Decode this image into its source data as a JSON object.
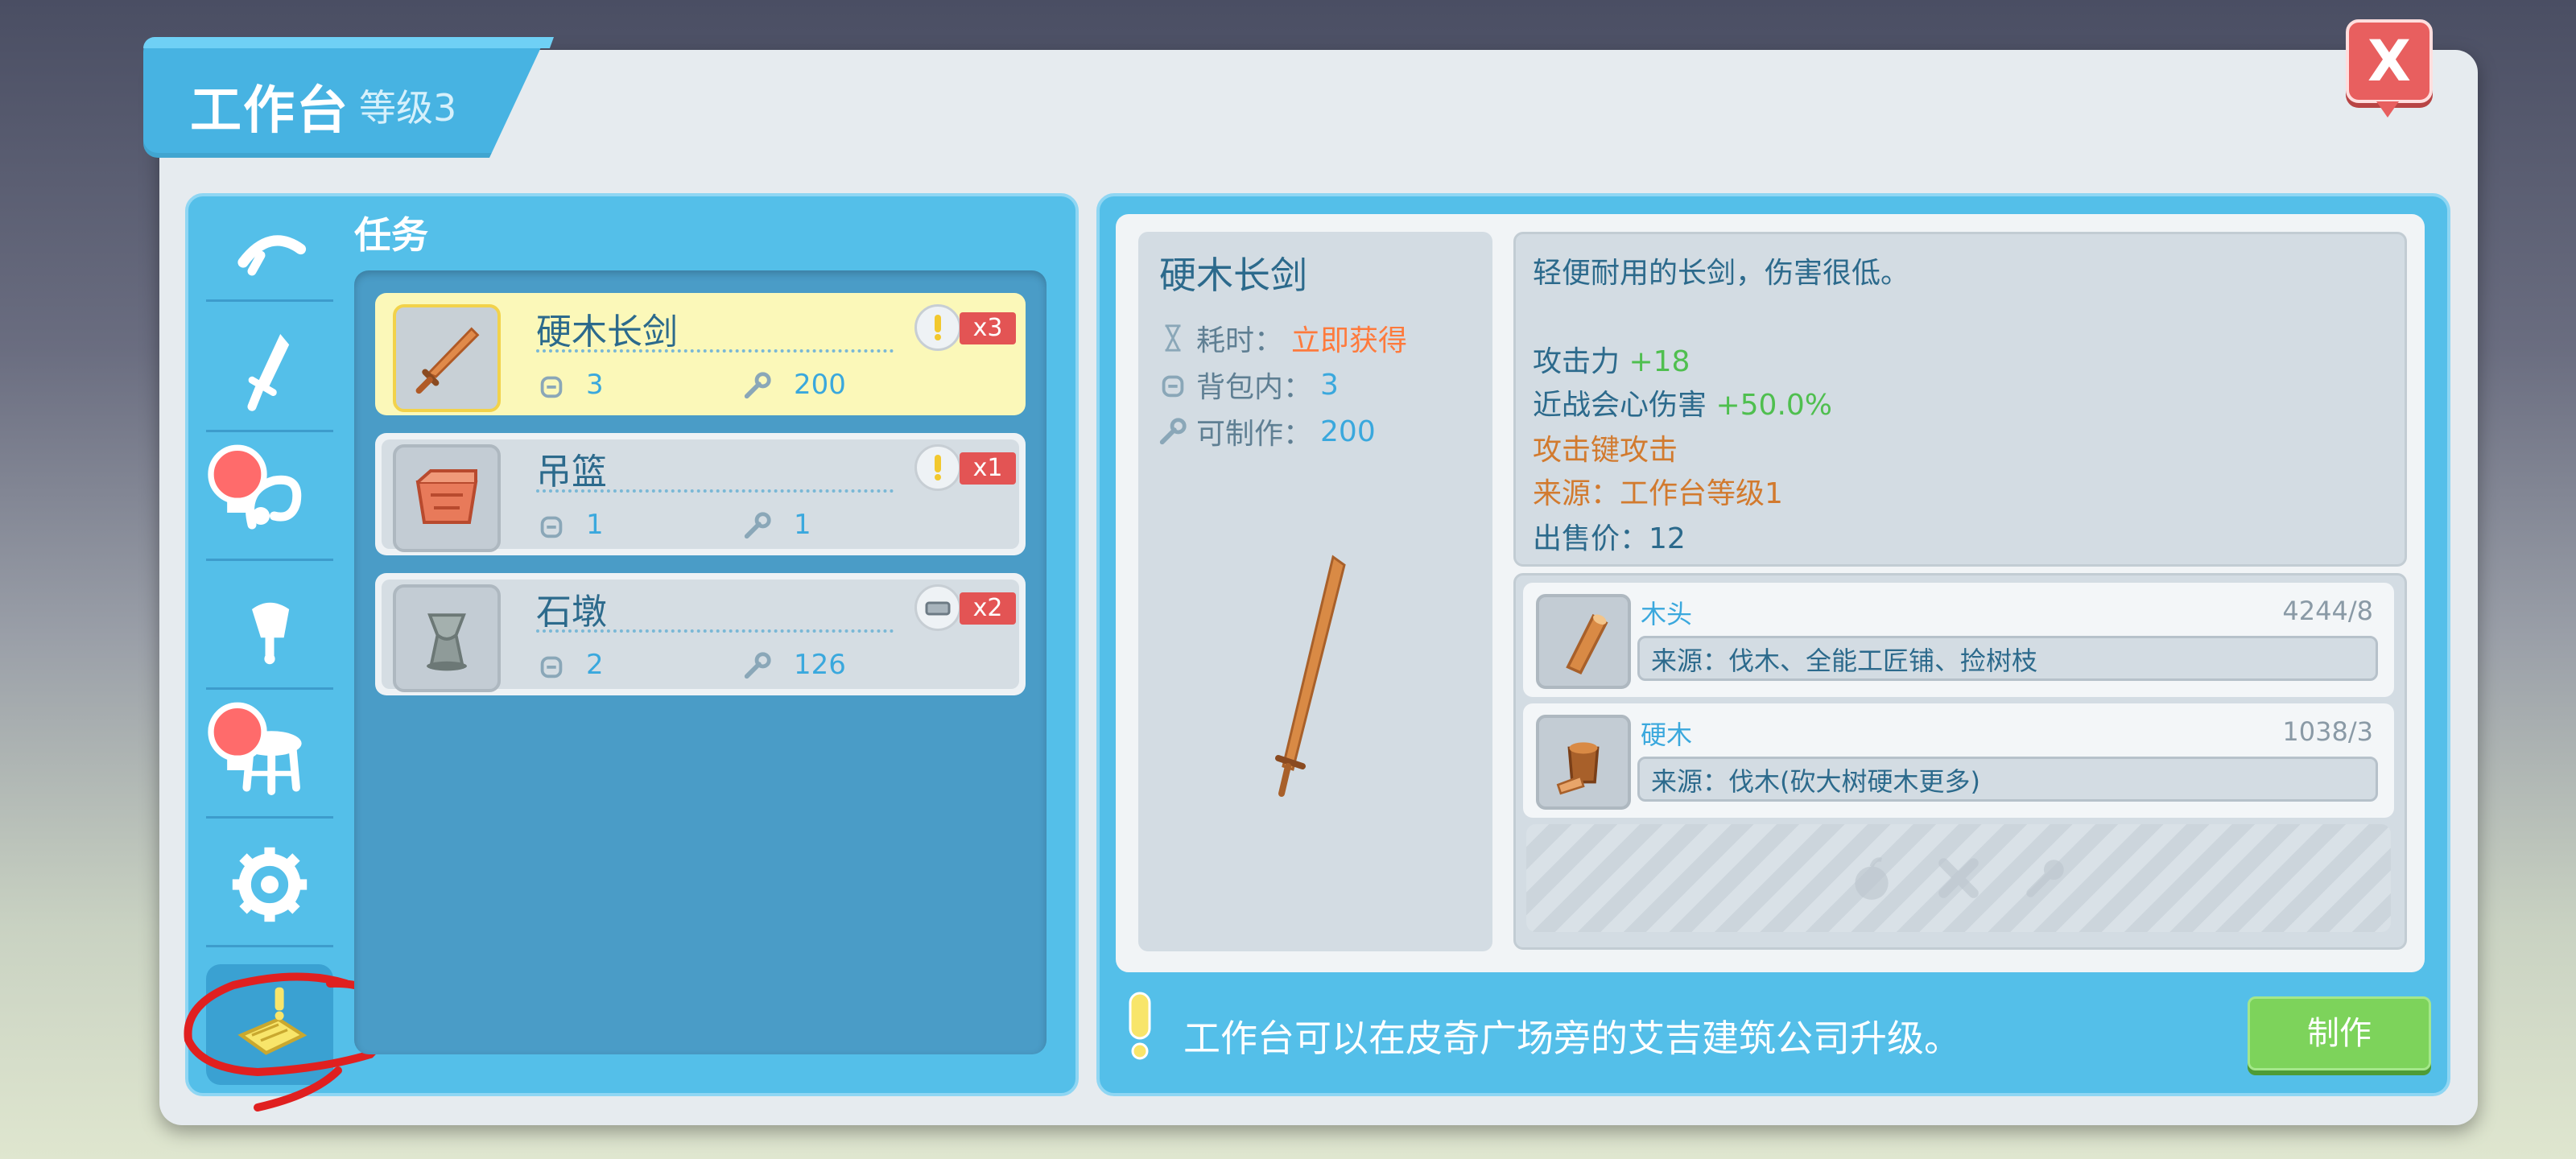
{
  "header": {
    "title": "工作台",
    "level": "等级3",
    "close_label": "X"
  },
  "sidebar": {
    "items": [
      {
        "icon": "pickaxe-icon",
        "alert": false
      },
      {
        "icon": "sword-icon",
        "alert": false
      },
      {
        "icon": "hook-icon",
        "alert": true
      },
      {
        "icon": "lamp-icon",
        "alert": false
      },
      {
        "icon": "stool-icon",
        "alert": true
      },
      {
        "icon": "gear-icon",
        "alert": false
      },
      {
        "icon": "task-board-icon",
        "alert": false,
        "selected": true
      }
    ]
  },
  "tasks": {
    "label": "任务",
    "items": [
      {
        "name": "硬木长剑",
        "bag_count": "3",
        "craftable": "200",
        "multiplier": "x3",
        "badge": "exclamation",
        "selected": true
      },
      {
        "name": "吊篮",
        "bag_count": "1",
        "craftable": "1",
        "multiplier": "x1",
        "badge": "exclamation",
        "selected": false
      },
      {
        "name": "石墩",
        "bag_count": "2",
        "craftable": "126",
        "multiplier": "x2",
        "badge": "bar",
        "selected": false
      }
    ]
  },
  "detail": {
    "name": "硬木长剑",
    "time_label": "耗时：",
    "time_value": "立即获得",
    "bag_label": "背包内：",
    "bag_value": "3",
    "craft_label": "可制作：",
    "craft_value": "200"
  },
  "description": {
    "text": "轻便耐用的长剑，伤害很低。",
    "attack_label": "攻击力",
    "attack_value": "+18",
    "crit_label": "近战会心伤害",
    "crit_value": "+50.0%",
    "attack_key": "攻击键攻击",
    "source": "来源：工作台等级1",
    "sell_price": "出售价：12"
  },
  "materials": [
    {
      "name": "木头",
      "count": "4244/8",
      "source": "来源：伐木、全能工匠铺、捡树枝"
    },
    {
      "name": "硬木",
      "count": "1038/3",
      "source": "来源：伐木(砍大树硬木更多)"
    }
  ],
  "footer": {
    "hint": "工作台可以在皮奇广场旁的艾吉建筑公司升级。",
    "make_label": "制作"
  },
  "colors": {
    "accent_blue": "#54bfe9",
    "selected_task": "#fbf8b9",
    "badge_red": "#e35454",
    "make_green": "#7dd35b",
    "close_red": "#e85f5f"
  }
}
